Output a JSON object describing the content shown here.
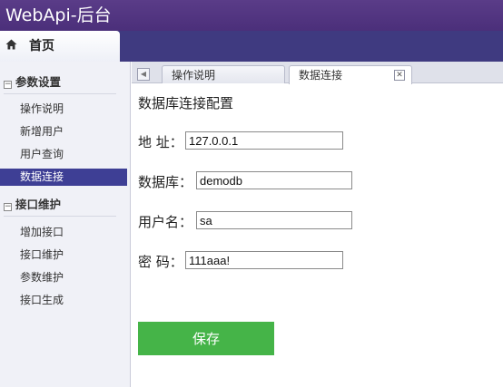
{
  "app": {
    "title": "WebApi-后台"
  },
  "home_tab": {
    "icon": "home-icon",
    "label": "首页"
  },
  "sidebar": {
    "groups": [
      {
        "label": "参数设置",
        "toggle": "−",
        "items": [
          "操作说明",
          "新增用户",
          "用户查询",
          "数据连接"
        ]
      },
      {
        "label": "接口维护",
        "toggle": "−",
        "items": [
          "增加接口",
          "接口维护",
          "参数维护",
          "接口生成"
        ]
      }
    ],
    "active_item": "数据连接"
  },
  "tabs": {
    "scroll_left": "◀",
    "items": [
      {
        "label": "操作说明"
      },
      {
        "label": "数据连接"
      }
    ],
    "close": "✕"
  },
  "form": {
    "title": "数据库连接配置",
    "fields": [
      {
        "label": "地 址：",
        "value": "127.0.0.1"
      },
      {
        "label": "数据库：",
        "value": "demodb"
      },
      {
        "label": "用户名：",
        "value": "sa"
      },
      {
        "label": "密 码：",
        "value": "111aaa!"
      }
    ],
    "save_label": "保存"
  },
  "colors": {
    "title_bar": "#4b2f7a",
    "band": "#3f3a80",
    "active_nav": "#3e3f95",
    "save_button": "#45b448"
  }
}
